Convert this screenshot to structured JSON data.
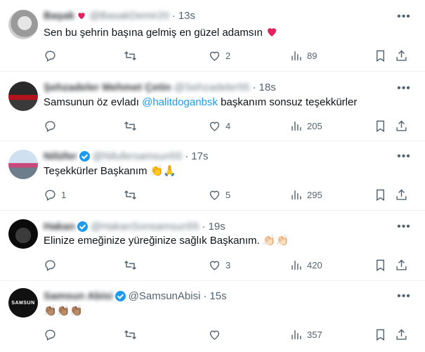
{
  "tweets": [
    {
      "name": "Başak",
      "handle": "@BasakDemir20",
      "time": "13s",
      "text": "Sen bu şehrin başına gelmiş en güzel adamsın ",
      "text_suffix_icon": "red-heart",
      "reply_count": "",
      "retweet_count": "",
      "like_count": "2",
      "view_count": "89"
    },
    {
      "name": "Şehzadeler Mehmet Çetin",
      "handle": "@Sehzadeler55",
      "time": "18s",
      "text_before": "Samsunun öz  evladı ",
      "mention": "@halitdoganbsk",
      "text_after": "  başkanım sonsuz teşekkürler",
      "reply_count": "",
      "retweet_count": "",
      "like_count": "4",
      "view_count": "205"
    },
    {
      "name": "Nilüfer",
      "handle": "@Nilufersamsun55",
      "time": "17s",
      "text": "Teşekkürler Başkanım ",
      "emojis": "👏🙏",
      "reply_count": "1",
      "retweet_count": "",
      "like_count": "5",
      "view_count": "295"
    },
    {
      "name": "Hakan",
      "handle": "@HakanSonsamsun55",
      "time": "19s",
      "text": "Elinize emeğinize yüreğinize sağlık Başkanım. ",
      "emojis": "👏🏻👏🏻",
      "reply_count": "",
      "retweet_count": "",
      "like_count": "3",
      "view_count": "420"
    },
    {
      "name": "Samsun Abisi",
      "handle": "@SamsunAbisi",
      "time": "15s",
      "emojis": "👏🏽👏🏽👏🏽",
      "avatar_text": "SAMSUN",
      "reply_count": "",
      "retweet_count": "",
      "like_count": "",
      "view_count": "357"
    }
  ],
  "separator": "·",
  "colors": {
    "accent": "#1d9bf0",
    "muted": "#536471",
    "text": "#0f1419",
    "heart": "#f4212e"
  },
  "icons": [
    "reply-icon",
    "retweet-icon",
    "like-icon",
    "views-icon",
    "bookmark-icon",
    "share-icon",
    "more-icon",
    "verified-badge-icon"
  ]
}
